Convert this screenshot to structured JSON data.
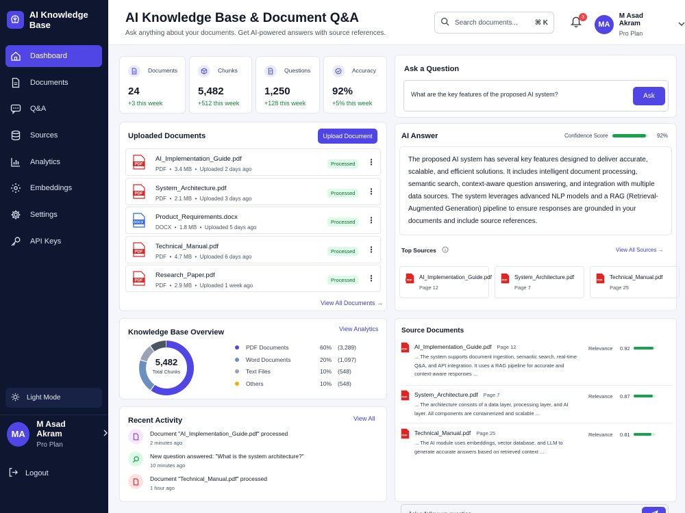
{
  "app": {
    "name": "AI Knowledge Base"
  },
  "sidebar": {
    "items": [
      {
        "label": "Dashboard",
        "icon": "home-icon"
      },
      {
        "label": "Documents",
        "icon": "document-icon"
      },
      {
        "label": "Q&A",
        "icon": "chat-icon"
      },
      {
        "label": "Sources",
        "icon": "database-icon"
      },
      {
        "label": "Analytics",
        "icon": "bar-chart-icon"
      },
      {
        "label": "Embeddings",
        "icon": "embedding-icon"
      },
      {
        "label": "Settings",
        "icon": "gear-icon"
      },
      {
        "label": "API Keys",
        "icon": "key-icon"
      }
    ],
    "light_mode": "Light Mode",
    "user": {
      "initials": "MA",
      "name": "M Asad Akram",
      "plan": "Pro Plan"
    },
    "logout": "Logout"
  },
  "header": {
    "title": "AI Knowledge Base & Document Q&A",
    "subtitle": "Ask anything about your documents. Get AI-powered answers with source references.",
    "search_placeholder": "Search documents...",
    "search_shortcut": "⌘ K",
    "notifications": "3",
    "user": {
      "initials": "MA",
      "name": "M Asad Akram",
      "plan": "Pro Plan"
    }
  },
  "stats": [
    {
      "label": "Documents",
      "value": "24",
      "delta": "+3 this week"
    },
    {
      "label": "Chunks",
      "value": "5,482",
      "delta": "+512 this week"
    },
    {
      "label": "Questions",
      "value": "1,250",
      "delta": "+128 this week"
    },
    {
      "label": "Accuracy",
      "value": "92%",
      "delta": "+5% this week"
    }
  ],
  "uploaded": {
    "title": "Uploaded Documents",
    "upload_button": "Upload Document",
    "view_all": "View All Documents →",
    "docs": [
      {
        "name": "AI_Implementation_Guide.pdf",
        "type": "PDF",
        "size": "3.4 MB",
        "uploaded": "Uploaded 2 days ago",
        "status": "Processed"
      },
      {
        "name": "System_Architecture.pdf",
        "type": "PDF",
        "size": "2.1 MB",
        "uploaded": "Uploaded 3 days ago",
        "status": "Processed"
      },
      {
        "name": "Product_Requirements.docx",
        "type": "DOCX",
        "size": "1.8 MB",
        "uploaded": "Uploaded 5 days ago",
        "status": "Processed"
      },
      {
        "name": "Technical_Manual.pdf",
        "type": "PDF",
        "size": "4.7 MB",
        "uploaded": "Uploaded 6 days ago",
        "status": "Processed"
      },
      {
        "name": "Research_Paper.pdf",
        "type": "PDF",
        "size": "2.9 MB",
        "uploaded": "Uploaded 1 week ago",
        "status": "Processed"
      }
    ]
  },
  "overview": {
    "title": "Knowledge Base Overview",
    "view_link": "View Analytics",
    "total": "5,482",
    "total_label": "Total Chunks",
    "segments": [
      {
        "name": "PDF Documents",
        "percent": 60,
        "pct_label": "60%",
        "count": "(3,289)",
        "color": "#4f46e5"
      },
      {
        "name": "Word Documents",
        "percent": 20,
        "pct_label": "20%",
        "count": "(1,097)",
        "color": "#6b8fbf"
      },
      {
        "name": "Text Files",
        "percent": 10,
        "pct_label": "10%",
        "count": "(548)",
        "color": "#9aa3b5"
      },
      {
        "name": "Others",
        "percent": 10,
        "pct_label": "10%",
        "count": "(548)",
        "color": "#eab308"
      }
    ]
  },
  "activity": {
    "title": "Recent Activity",
    "view_link": "View All",
    "items": [
      {
        "text": "Document \"AI_Implementation_Guide.pdf\" processed",
        "time": "2 minutes ago",
        "icon": "document-icon"
      },
      {
        "text": "New question answered: \"What is the system architecture?\"",
        "time": "10 minutes ago",
        "icon": "search-icon"
      },
      {
        "text": "Document \"Technical_Manual.pdf\" processed",
        "time": "1 hour ago",
        "icon": "document-icon"
      }
    ]
  },
  "ask": {
    "title": "Ask a Question",
    "question": "What are the key features of the proposed AI system?",
    "button": "Ask"
  },
  "answer": {
    "title": "AI Answer",
    "confidence_label": "Confidence Score",
    "confidence": 92,
    "confidence_text": "92%",
    "text": "The proposed AI system has several key features designed to deliver accurate, scalable, and efficient solutions. It includes intelligent document processing, semantic search, context-aware question answering, and integration with multiple data sources. The system leverages advanced NLP models and a RAG (Retrieval-Augmented Generation) pipeline to ensure responses are grounded in your documents and include source references.",
    "top_sources_label": "Top Sources",
    "view_sources": "View All Sources →",
    "sources": [
      {
        "name": "AI_Implementation_Guide.pdf",
        "page": "Page 12"
      },
      {
        "name": "System_Architecture.pdf",
        "page": "Page 7"
      },
      {
        "name": "Technical_Manual.pdf",
        "page": "Page 25"
      }
    ]
  },
  "source_docs": {
    "title": "Source Documents",
    "relevance_label": "Relevance",
    "items": [
      {
        "name": "AI_Implementation_Guide.pdf",
        "page": "Page 12",
        "snippet": "... The system supports document ingestion, semantic search, real-time Q&A, and API integration. It uses a RAG pipeline for accurate and context-aware responses ...",
        "relevance": 0.92,
        "relevance_text": "0.92"
      },
      {
        "name": "System_Architecture.pdf",
        "page": "Page 7",
        "snippet": "... The architecture consists of a data layer, processing layer, and AI layer. All components are containerized and scalable ...",
        "relevance": 0.87,
        "relevance_text": "0.87"
      },
      {
        "name": "Technical_Manual.pdf",
        "page": "Page 25",
        "snippet": "... The AI module uses embeddings, vector database, and LLM to generate accurate answers based on retrieved context ...",
        "relevance": 0.81,
        "relevance_text": "0.81"
      }
    ],
    "followup_placeholder": "Ask a follow-up question..."
  }
}
